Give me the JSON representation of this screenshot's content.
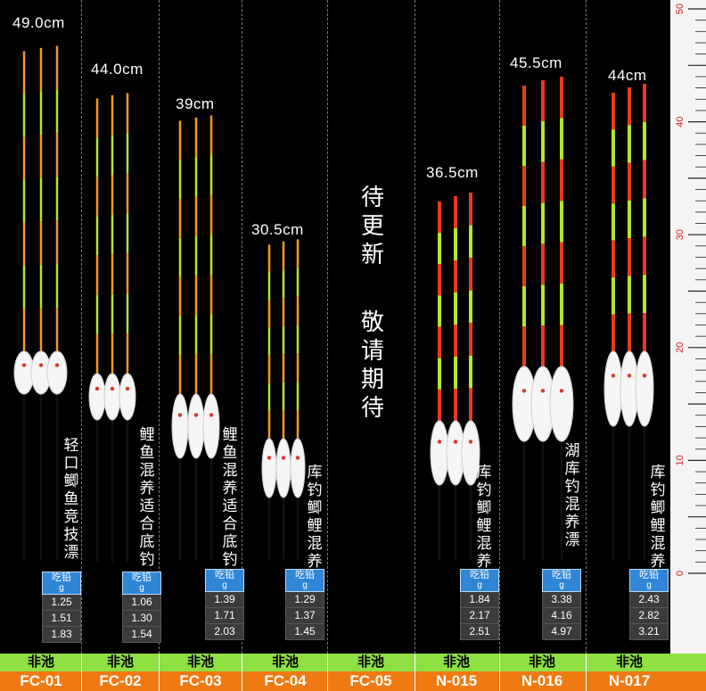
{
  "center_notice": {
    "line1": "待更新",
    "line2": "敬请期待"
  },
  "table_header": {
    "label": "吃铅",
    "unit": "g"
  },
  "ruler": {
    "marks": [
      "50",
      "40",
      "30",
      "20",
      "10",
      "0"
    ]
  },
  "colors": {
    "orange_tip": "#f39a1c",
    "green_tip": "#b6e62a",
    "red_tip": "#e93a1c",
    "body": "#f5f5f5",
    "stem": "#111111"
  },
  "products": [
    {
      "length": "49.0cm",
      "desc": "轻口鲫鱼竞技漂",
      "pond": "非池",
      "model": "FC-01",
      "weights": [
        "1.25",
        "1.51",
        "1.83"
      ],
      "tip": "orange"
    },
    {
      "length": "44.0cm",
      "desc": "鲤鱼混养适合底钓",
      "pond": "非池",
      "model": "FC-02",
      "weights": [
        "1.06",
        "1.30",
        "1.54"
      ],
      "tip": "orange"
    },
    {
      "length": "39cm",
      "desc": "鲤鱼混养适合底钓",
      "pond": "非池",
      "model": "FC-03",
      "weights": [
        "1.39",
        "1.71",
        "2.03"
      ],
      "tip": "orange"
    },
    {
      "length": "30.5cm",
      "desc": "库钓鲫鲤混养",
      "pond": "非池",
      "model": "FC-04",
      "weights": [
        "1.29",
        "1.37",
        "1.45"
      ],
      "tip": "orange"
    },
    {
      "length": "",
      "desc": "",
      "pond": "非池",
      "model": "FC-05",
      "weights": [],
      "tip": "none"
    },
    {
      "length": "36.5cm",
      "desc": "库钓鲫鲤混养",
      "pond": "非池",
      "model": "N-015",
      "weights": [
        "1.84",
        "2.17",
        "2.51"
      ],
      "tip": "red"
    },
    {
      "length": "45.5cm",
      "desc": "湖库钓混养漂",
      "pond": "非池",
      "model": "N-016",
      "weights": [
        "3.38",
        "4.16",
        "4.97"
      ],
      "tip": "red"
    },
    {
      "length": "44cm",
      "desc": "库钓鲫鲤混养",
      "pond": "非池",
      "model": "N-017",
      "weights": [
        "2.43",
        "2.82",
        "3.21"
      ],
      "tip": "red"
    }
  ]
}
